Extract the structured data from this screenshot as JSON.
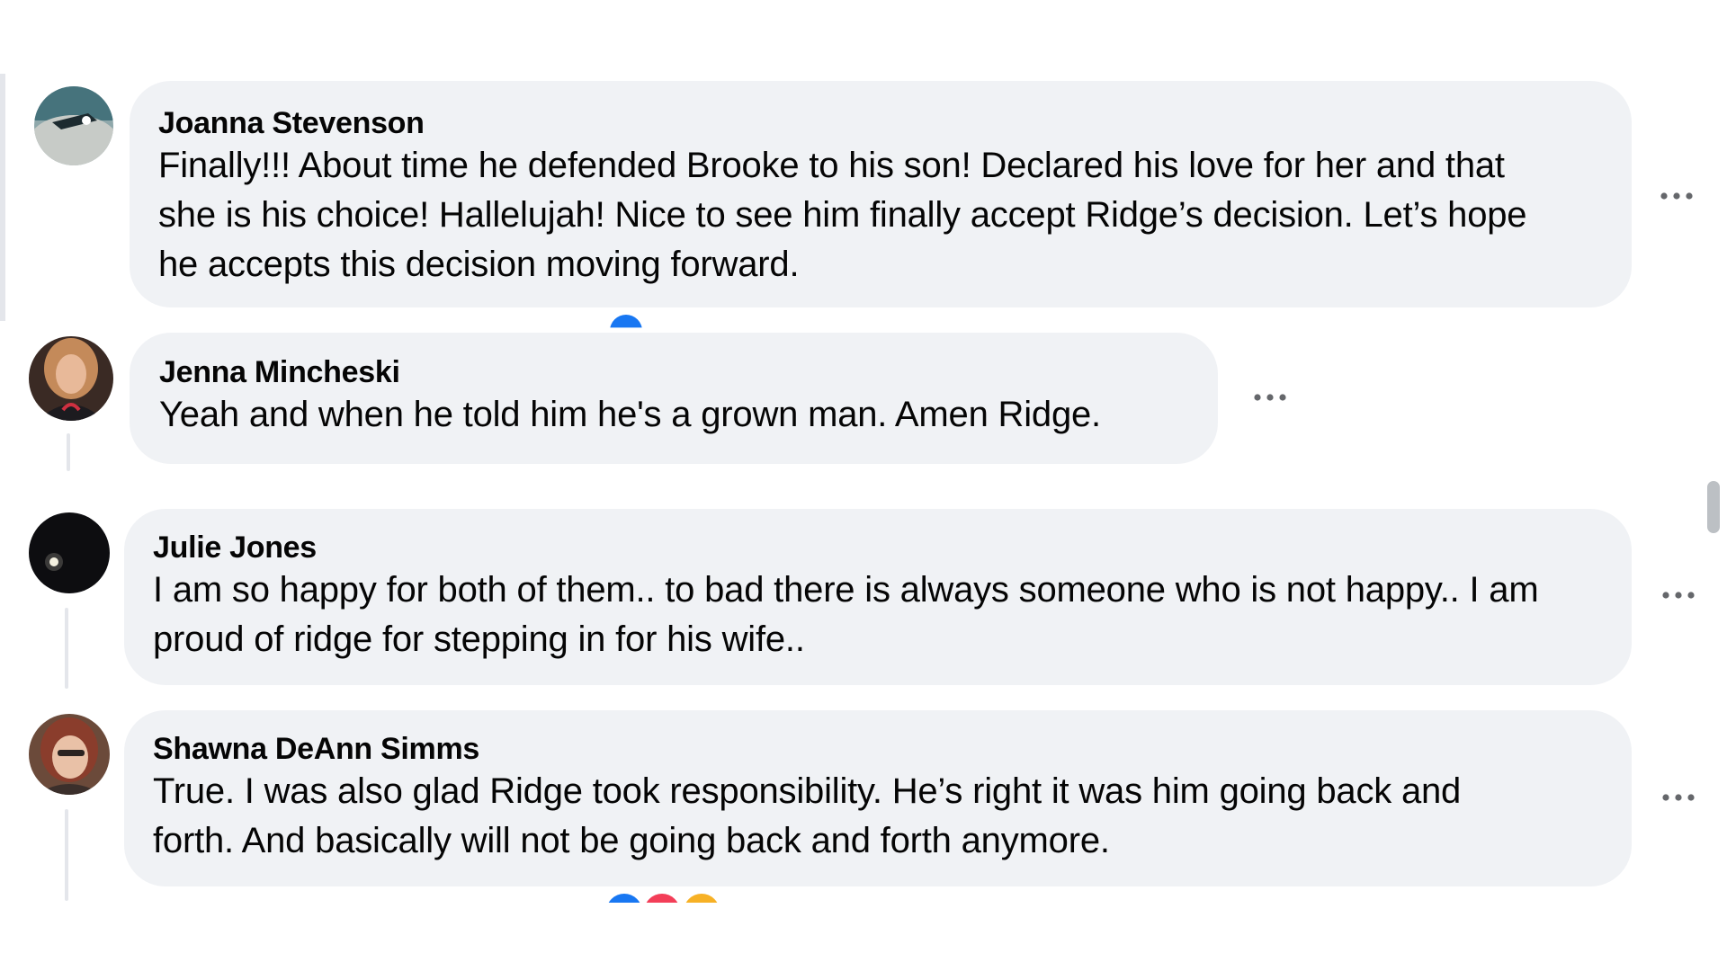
{
  "comments": [
    {
      "author": "Joanna Stevenson",
      "lines": [
        "Finally!!! About time he defended Brooke to his son! Declared his love for her and that",
        "she is his choice! Hallelujah! Nice to see him finally accept Ridge’s decision. Let’s hope",
        "he accepts this decision moving forward."
      ],
      "more_icon": "more-horizontal-icon"
    },
    {
      "author": "Jenna Mincheski",
      "lines": [
        "Yeah and when he told him he's a grown man. Amen Ridge."
      ],
      "more_icon": "more-horizontal-icon"
    },
    {
      "author": "Julie Jones",
      "lines": [
        "I am so happy for both of them.. to bad there is always someone who is not happy.. I am",
        "proud of ridge for stepping in for his wife.."
      ],
      "more_icon": "more-horizontal-icon"
    },
    {
      "author": "Shawna DeAnn Simms",
      "lines": [
        "True. I was also glad Ridge took responsibility. He’s right it was him going back and",
        "forth. And basically will not be going back and forth anymore."
      ],
      "more_icon": "more-horizontal-icon"
    }
  ],
  "colors": {
    "bubble": "#f0f2f5",
    "like_blue": "#1877f2",
    "love_red": "#f33e58",
    "haha_yellow": "#f7b125"
  }
}
